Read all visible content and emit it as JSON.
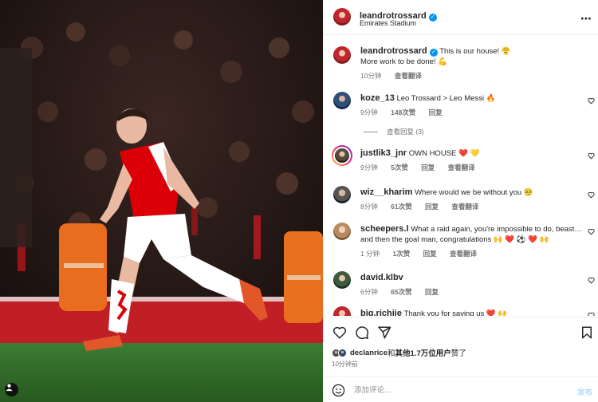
{
  "colors": {
    "accent": "#0095f6",
    "arsenal_red": "#db0007",
    "muted": "#737373",
    "pitch": "#2f6d2a"
  },
  "photo": {
    "alt_icon": "user-tag-icon"
  },
  "header": {
    "username": "leandrotrossard",
    "location": "Emirates Stadium",
    "more_icon": "⋯"
  },
  "caption": {
    "username": "leandrotrossard",
    "line1": "This is our house! 😤",
    "line2": "More work to be done! 💪",
    "time": "10分钟",
    "translate": "查看翻译"
  },
  "comments": [
    {
      "username": "koze_13",
      "text": "Leo Trossard > Leo Messi 🔥",
      "time": "9分钟",
      "likes": "148次赞",
      "reply": "回复",
      "translate": ""
    },
    {
      "username": "justlik3_jnr",
      "text": "OWN HOUSE ❤️ 💛",
      "time": "9分钟",
      "likes": "5次赞",
      "reply": "回复",
      "translate": "查看翻译"
    },
    {
      "username": "wiz__kharim",
      "text": "Where would we be without you 🥺",
      "time": "8分钟",
      "likes": "61次赞",
      "reply": "回复",
      "translate": "查看翻译"
    },
    {
      "username": "scheepers.l",
      "text": "What a raid again, you're impossible to do, beast… and then the goal man, congratulations 🙌 ❤️ ⚽ ❤️ 🙌",
      "time": "1 分钟",
      "likes": "1次赞",
      "reply": "回复",
      "translate": "查看翻译"
    },
    {
      "username": "david.klbv",
      "text": "",
      "time": "6分钟",
      "likes": "65次赞",
      "reply": "回复",
      "translate": ""
    },
    {
      "username": "big.richiie",
      "text": "Thank you for saving us ❤️ 🙌",
      "time": "",
      "likes": "",
      "reply": "",
      "translate": ""
    }
  ],
  "view_replies": "查看回复 (3)",
  "likes_line": {
    "user": "declanrice",
    "mid": "和",
    "others": "其他1.7万位用户",
    "end": "赞了"
  },
  "post_time": "10分钟前",
  "add_comment": {
    "placeholder": "添加评论...",
    "post": "发布"
  }
}
